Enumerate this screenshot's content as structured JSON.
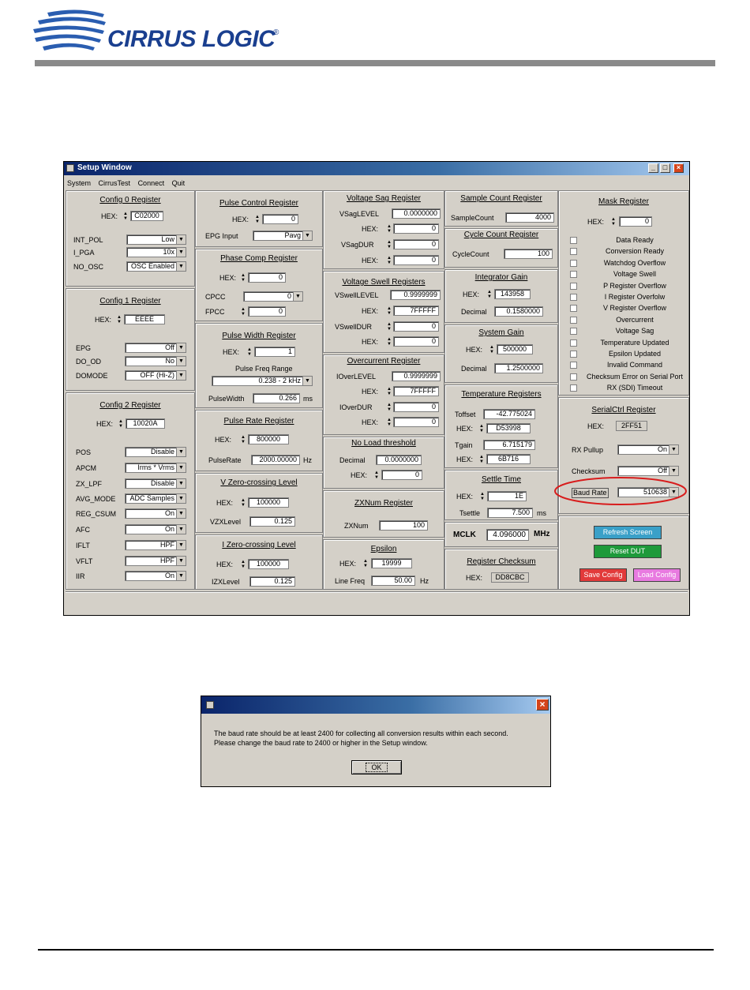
{
  "header": {
    "brand": "CIRRUS LOGIC",
    "registered": "®"
  },
  "window": {
    "title": "Setup Window",
    "menu": [
      "System",
      "CirrusTest",
      "Connect",
      "Quit"
    ]
  },
  "config0": {
    "title": "Config 0 Register",
    "hex_label": "HEX:",
    "hex": "C02000",
    "rows": [
      {
        "label": "INT_POL",
        "value": "Low"
      },
      {
        "label": "I_PGA",
        "value": "10x"
      },
      {
        "label": "NO_OSC",
        "value": "OSC Enabled"
      }
    ]
  },
  "config1": {
    "title": "Config 1 Register",
    "hex_label": "HEX:",
    "hex": "EEEE",
    "rows": [
      {
        "label": "EPG",
        "value": "Off"
      },
      {
        "label": "DO_OD",
        "value": "No"
      },
      {
        "label": "DOMODE",
        "value": "OFF (Hi-Z)"
      }
    ]
  },
  "config2": {
    "title": "Config 2 Register",
    "hex_label": "HEX:",
    "hex": "10020A",
    "rows": [
      {
        "label": "POS",
        "value": "Disable"
      },
      {
        "label": "APCM",
        "value": "Irms * Vrms"
      },
      {
        "label": "ZX_LPF",
        "value": "Disable"
      },
      {
        "label": "AVG_MODE",
        "value": "ADC Samples"
      },
      {
        "label": "REG_CSUM",
        "value": "On"
      },
      {
        "label": "AFC",
        "value": "On"
      },
      {
        "label": "IFLT",
        "value": "HPF"
      },
      {
        "label": "VFLT",
        "value": "HPF"
      },
      {
        "label": "IIR",
        "value": "On"
      }
    ]
  },
  "pulse_control": {
    "title": "Pulse Control Register",
    "hex_label": "HEX:",
    "hex": "0",
    "epg_label": "EPG Input",
    "epg_value": "Pavg"
  },
  "phase_comp": {
    "title": "Phase Comp Register",
    "hex_label": "HEX:",
    "hex": "0",
    "cpcc_label": "CPCC",
    "cpcc": "0",
    "fpcc_label": "FPCC",
    "fpcc": "0"
  },
  "pulse_width": {
    "title": "Pulse Width Register",
    "hex_label": "HEX:",
    "hex": "1",
    "freq_range_label": "Pulse Freq Range",
    "freq_range": "0.238 - 2 kHz",
    "pw_label": "PulseWidth",
    "pw": "0.266",
    "pw_unit": "ms"
  },
  "pulse_rate": {
    "title": "Pulse Rate Register",
    "hex_label": "HEX:",
    "hex": "800000",
    "rate_label": "PulseRate",
    "rate": "2000.00000",
    "rate_unit": "Hz"
  },
  "vzero": {
    "title": "V Zero-crossing Level",
    "hex_label": "HEX:",
    "hex": "100000",
    "level_label": "VZXLevel",
    "level": "0.125"
  },
  "izero": {
    "title": "I Zero-crossing Level",
    "hex_label": "HEX:",
    "hex": "100000",
    "level_label": "IZXLevel",
    "level": "0.125"
  },
  "vsag": {
    "title": "Voltage Sag Register",
    "level_label": "VSagLEVEL",
    "level": "0.0000000",
    "hex_label": "HEX:",
    "hex1": "0",
    "dur_label": "VSagDUR",
    "dur": "0",
    "hex2": "0"
  },
  "vswell": {
    "title": "Voltage Swell Registers",
    "level_label": "VSwellLEVEL",
    "level": "0.9999999",
    "hex_label": "HEX:",
    "hex1": "7FFFFF",
    "dur_label": "VSwellDUR",
    "dur": "0",
    "hex2": "0"
  },
  "overcurrent": {
    "title": "Overcurrent Register",
    "level_label": "IOverLEVEL",
    "level": "0.9999999",
    "hex_label": "HEX:",
    "hex1": "7FFFFF",
    "dur_label": "IOverDUR",
    "dur": "0",
    "hex2": "0"
  },
  "noload": {
    "title": "No Load threshold",
    "dec_label": "Decimal",
    "dec": "0.0000000",
    "hex_label": "HEX:",
    "hex": "0"
  },
  "zxnum": {
    "title": "ZXNum Register",
    "label": "ZXNum",
    "value": "100"
  },
  "epsilon": {
    "title": "Epsilon",
    "hex_label": "HEX:",
    "hex": "19999",
    "lf_label": "Line Freq",
    "lf": "50.00",
    "lf_unit": "Hz"
  },
  "sample_count": {
    "title": "Sample Count Register",
    "label": "SampleCount",
    "value": "4000"
  },
  "cycle_count": {
    "title": "Cycle Count Register",
    "label": "CycleCount",
    "value": "100"
  },
  "integrator": {
    "title": "Integrator Gain",
    "hex_label": "HEX:",
    "hex": "143958",
    "dec_label": "Decimal",
    "dec": "0.1580000"
  },
  "system_gain": {
    "title": "System Gain",
    "hex_label": "HEX:",
    "hex": "500000",
    "dec_label": "Decimal",
    "dec": "1.2500000"
  },
  "temperature": {
    "title": "Temperature Registers",
    "toff_label": "Toffset",
    "toff": "-42.775024",
    "hex_label": "HEX:",
    "hex1": "D53998",
    "tgain_label": "Tgain",
    "tgain": "6.715179",
    "hex2": "6B716"
  },
  "settle": {
    "title": "Settle Time",
    "hex_label": "HEX:",
    "hex": "1E",
    "ts_label": "Tsettle",
    "ts": "7.500",
    "ts_unit": "ms"
  },
  "mclk": {
    "label": "MCLK",
    "value": "4.096000",
    "unit": "MHz"
  },
  "checksum": {
    "title": "Register Checksum",
    "hex_label": "HEX:",
    "hex": "DD8CBC"
  },
  "mask": {
    "title": "Mask Register",
    "hex_label": "HEX:",
    "hex": "0",
    "items": [
      "Data Ready",
      "Conversion Ready",
      "Watchdog Overflow",
      "Voltage Swell",
      "P Register Overflow",
      "I Register Overfolw",
      "V Register Overflow",
      "Overcurrent",
      "Voltage Sag",
      "Temperature Updated",
      "Epsilon Updated",
      "Invalid Command",
      "Checksum Error on Serial Port",
      "RX (SDI) Timeout"
    ]
  },
  "serialctrl": {
    "title": "SerialCtrl Register",
    "hex_label": "HEX:",
    "hex": "2FF51",
    "rx_label": "RX Pullup",
    "rx": "On",
    "cs_label": "Checksum",
    "cs": "Off",
    "baud_label": "Baud Rate",
    "baud": "510638"
  },
  "buttons": {
    "refresh": "Refresh Screen",
    "reset": "Reset DUT",
    "save": "Save Config",
    "load": "Load Config"
  },
  "dialog": {
    "line1": "The baud rate should be at least 2400 for collecting all conversion results within each second.",
    "line2": "Please change the baud rate to 2400 or higher in the Setup window.",
    "ok": "OK"
  },
  "colors": {
    "refresh": "#3aa0c8",
    "reset": "#1e9a3a",
    "save": "#e23a3a",
    "load": "#e87ae0",
    "highlight": "#d81c1c",
    "brand": "#1a3f8f"
  }
}
